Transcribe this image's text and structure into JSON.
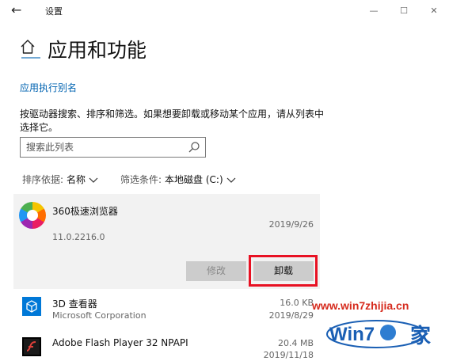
{
  "window": {
    "back_glyph": "←",
    "title": "设置",
    "controls": [
      "—",
      "☐",
      "✕"
    ]
  },
  "page": {
    "title": "应用和功能",
    "alias_link": "应用执行别名",
    "description": "按驱动器搜索、排序和筛选。如果想要卸载或移动某个应用，请从列表中选择它。"
  },
  "search": {
    "placeholder": "搜索此列表",
    "icon": "search-icon"
  },
  "sort": {
    "label": "排序依据:",
    "value": "名称"
  },
  "filter": {
    "label": "筛选条件:",
    "value": "本地磁盘 (C:)"
  },
  "apps": [
    {
      "name": "360极速浏览器",
      "version": "11.0.2216.0",
      "date": "2019/9/26",
      "icon": "360-browser-icon",
      "expanded": true,
      "modify_label": "修改",
      "uninstall_label": "卸载"
    },
    {
      "name": "3D 查看器",
      "publisher": "Microsoft Corporation",
      "size": "16.0 KB",
      "date": "2019/8/29",
      "icon": "3d-viewer-icon"
    },
    {
      "name": "Adobe Flash Player 32 NPAPI",
      "size": "20.4 MB",
      "date": "2019/11/18",
      "icon": "flash-icon"
    }
  ],
  "watermark": {
    "url": "www.win7zhijia.cn",
    "logo_text": "Win7",
    "logo_char": "家"
  },
  "colors": {
    "accent": "#0063b1",
    "highlight": "#e81123",
    "panel": "#f2f2f2",
    "button": "#cccccc"
  }
}
